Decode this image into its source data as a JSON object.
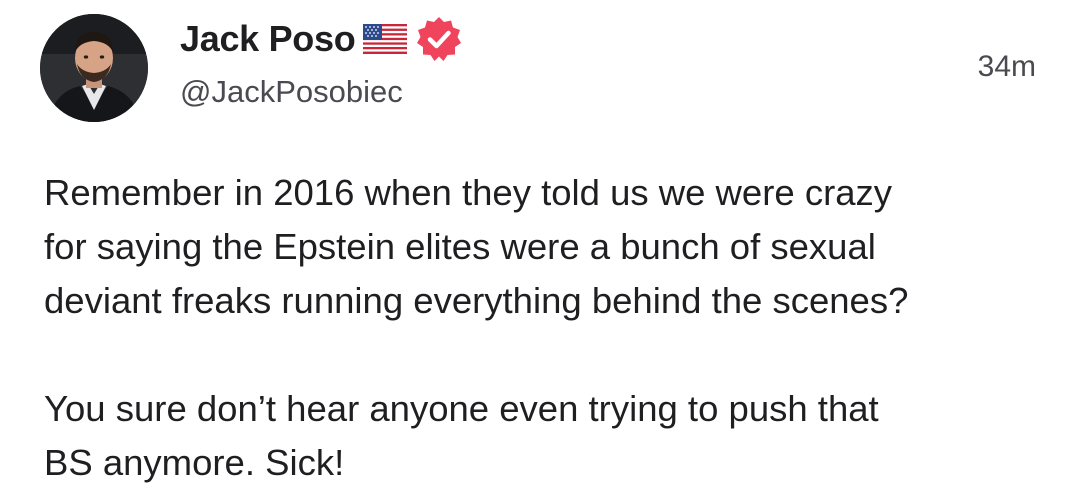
{
  "author": {
    "display_name": "Jack Poso",
    "handle": "@JackPosobiec",
    "flag_icon": "us-flag-icon",
    "verified_icon": "verified-badge-icon",
    "verified_color": "#f0445c"
  },
  "post": {
    "timestamp": "34m",
    "paragraphs": [
      "Remember in 2016 when they told us we were crazy\nfor saying the Epstein elites were a bunch of sexual\ndeviant freaks running everything behind the scenes?",
      "You sure don’t hear anyone even trying to push that\nBS anymore. Sick!"
    ]
  }
}
